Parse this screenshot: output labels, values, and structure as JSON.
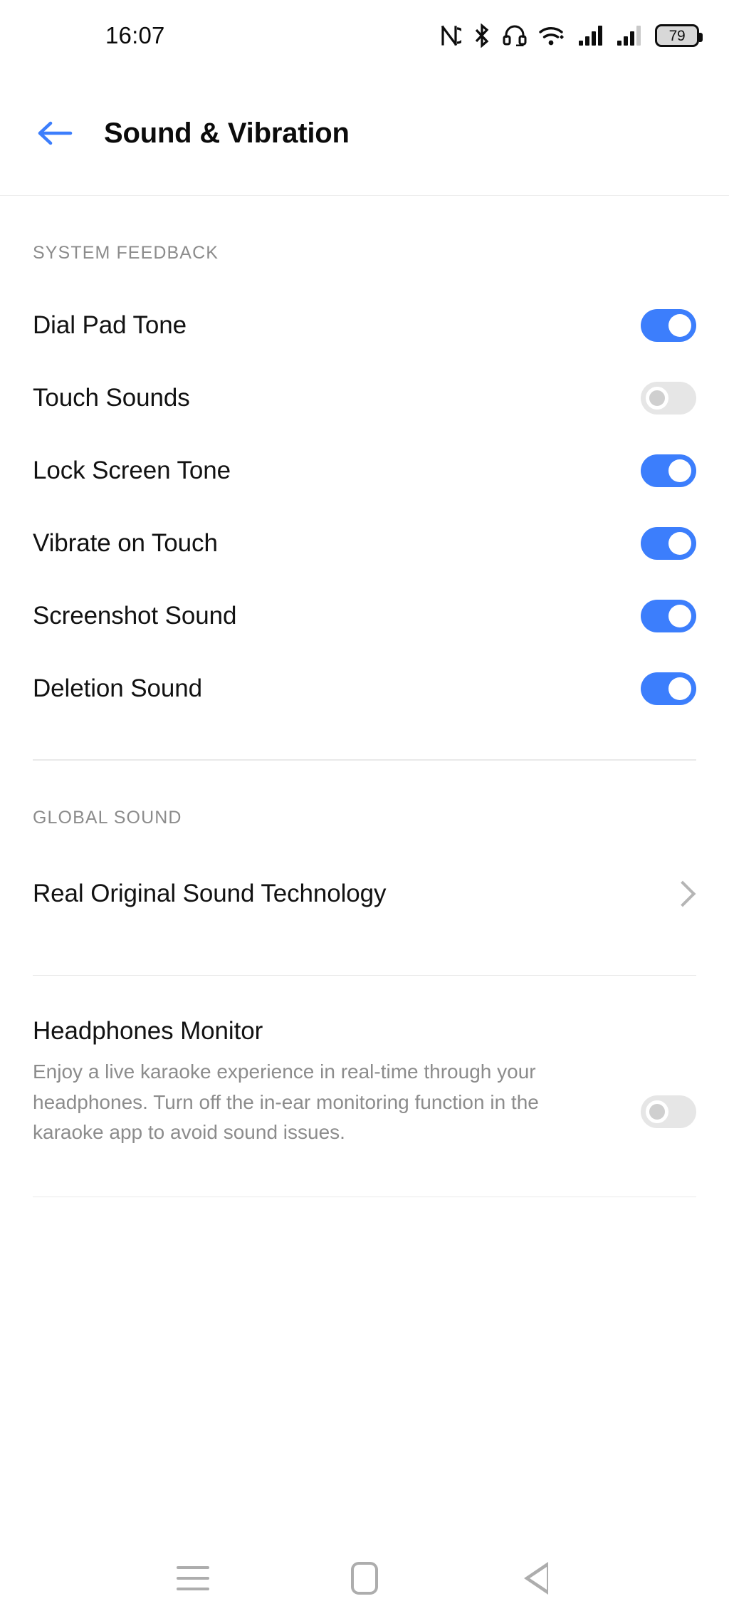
{
  "status_bar": {
    "time": "16:07",
    "battery_level": "79",
    "icons": [
      "nfc-icon",
      "bluetooth-icon",
      "headset-icon",
      "wifi-icon",
      "cellular-signal-1-icon",
      "cellular-signal-2-icon",
      "battery-icon"
    ]
  },
  "header": {
    "back_label": "back-arrow",
    "title": "Sound & Vibration",
    "accent_color": "#3c7efc"
  },
  "sections": {
    "system_feedback": {
      "label": "SYSTEM FEEDBACK",
      "items": [
        {
          "label": "Dial Pad Tone",
          "state": "on"
        },
        {
          "label": "Touch Sounds",
          "state": "off"
        },
        {
          "label": "Lock Screen Tone",
          "state": "on"
        },
        {
          "label": "Vibrate on Touch",
          "state": "on"
        },
        {
          "label": "Screenshot Sound",
          "state": "on"
        },
        {
          "label": "Deletion Sound",
          "state": "on"
        }
      ]
    },
    "global_sound": {
      "label": "GLOBAL SOUND",
      "items": [
        {
          "label": "Real Original Sound Technology",
          "accessory": "chevron-right"
        }
      ]
    },
    "headphones_monitor": {
      "title": "Headphones Monitor",
      "description": "Enjoy a live karaoke experience in real-time through your headphones. Turn off the in-ear monitoring function in the karaoke app to avoid sound issues.",
      "state": "off"
    }
  },
  "nav_bar": {
    "recents_label": "recents-button",
    "home_label": "home-button",
    "back_label": "back-button"
  },
  "colors": {
    "toggle_on": "#3c7efc",
    "toggle_off": "#e6e6e6",
    "text_primary": "#121212",
    "text_secondary": "#8c8c8c",
    "divider": "#e9e9e9"
  }
}
